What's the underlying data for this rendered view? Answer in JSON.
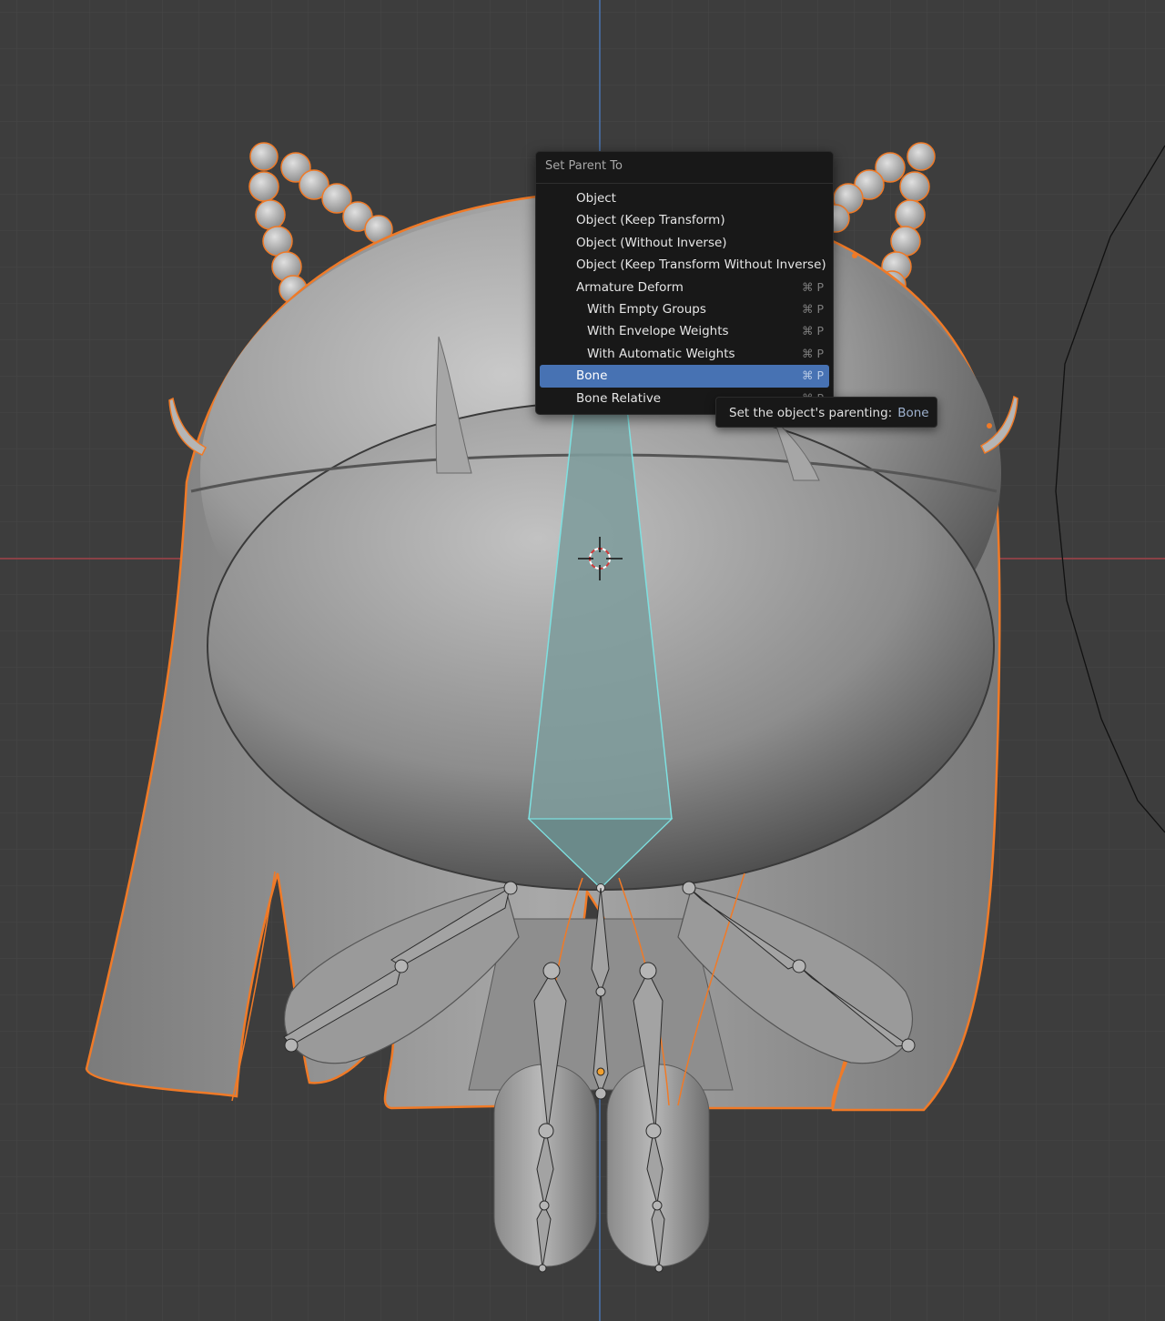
{
  "menu": {
    "title": "Set Parent To",
    "items": [
      {
        "label": "Object",
        "shortcut": ""
      },
      {
        "label": "Object (Keep Transform)",
        "shortcut": ""
      },
      {
        "label": "Object (Without Inverse)",
        "shortcut": ""
      },
      {
        "label": "Object (Keep Transform Without Inverse)",
        "shortcut": ""
      },
      {
        "label": "Armature Deform",
        "shortcut": "⌘ P"
      },
      {
        "label": "With Empty Groups",
        "shortcut": "⌘ P"
      },
      {
        "label": "With Envelope Weights",
        "shortcut": "⌘ P"
      },
      {
        "label": "With Automatic Weights",
        "shortcut": "⌘ P"
      },
      {
        "label": "Bone",
        "shortcut": "⌘ P"
      },
      {
        "label": "Bone Relative",
        "shortcut": "⌘ P"
      }
    ],
    "active_item": "Bone"
  },
  "tooltip": {
    "text": "Set the object's parenting:",
    "value": "Bone"
  },
  "colors": {
    "viewport_bg": "#3d3d3d",
    "grid": "#4a4a4a",
    "x_axis": "#b5424a",
    "y_axis": "#4b7ec9",
    "selection_outline": "#f07a27",
    "active_bone": "#7ee0e0",
    "menu_highlight": "#4772b3"
  },
  "icons": [
    "3d-cursor-icon"
  ]
}
